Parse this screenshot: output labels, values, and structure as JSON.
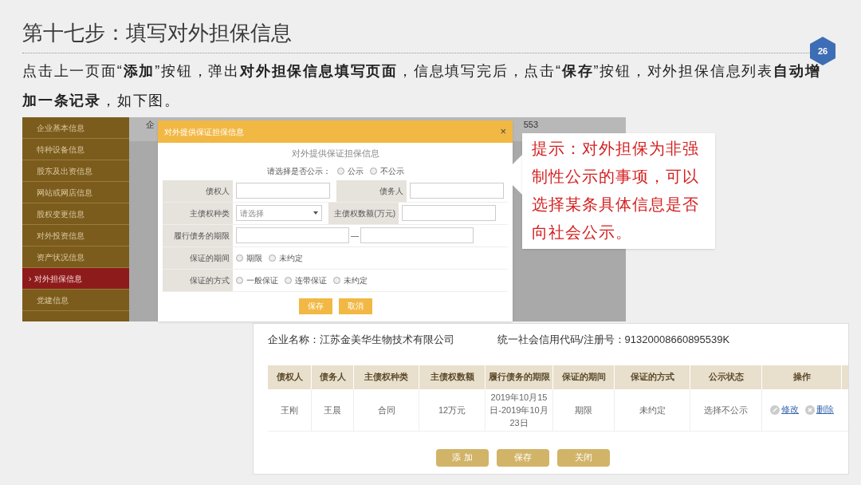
{
  "slide": {
    "title": "第十七步：填写对外担保信息",
    "page_number": "26",
    "description": "点击上一页面“**添加**”按钮，弹出**对外担保信息填写页面**，信息填写完后，点击“**保存**”按钮，对外担保信息列表**自动增加一条记录**，如下图。"
  },
  "form_screenshot": {
    "sidebar": [
      {
        "label": "企业基本信息",
        "selected": false
      },
      {
        "label": "特种设备信息",
        "selected": false
      },
      {
        "label": "股东及出资信息",
        "selected": false
      },
      {
        "label": "网站或网店信息",
        "selected": false
      },
      {
        "label": "股权变更信息",
        "selected": false
      },
      {
        "label": "对外投资信息",
        "selected": false
      },
      {
        "label": "资产状况信息",
        "selected": false
      },
      {
        "label": "对外担保信息",
        "selected": true,
        "marker": "›"
      },
      {
        "label": "党建信息",
        "selected": false
      }
    ],
    "background_texts": [
      "企",
      "553"
    ],
    "dialog": {
      "title": "对外提供保证担保信息",
      "close": "×",
      "heading": "对外提供保证担保信息",
      "publicity_prompt": "请选择是否公示：",
      "publicity_options": [
        {
          "label": "公示",
          "selected": false
        },
        {
          "label": "不公示",
          "selected": false
        }
      ],
      "rows": [
        [
          {
            "kind": "text",
            "label": "债权人"
          },
          {
            "kind": "text",
            "label": "债务人"
          }
        ],
        [
          {
            "kind": "select",
            "label": "主债权种类",
            "placeholder": "请选择"
          },
          {
            "kind": "text",
            "label": "主债权数额(万元)"
          }
        ],
        [
          {
            "kind": "range",
            "label": "履行债务的期限",
            "separator": "—"
          }
        ],
        [
          {
            "kind": "radio",
            "label": "保证的期间",
            "options": [
              {
                "label": "期限",
                "selected": false
              },
              {
                "label": "未约定",
                "selected": false
              }
            ]
          }
        ],
        [
          {
            "kind": "radio",
            "label": "保证的方式",
            "options": [
              {
                "label": "一般保证",
                "selected": false
              },
              {
                "label": "连带保证",
                "selected": false
              },
              {
                "label": "未约定",
                "selected": false
              }
            ]
          }
        ]
      ],
      "buttons": [
        "保存",
        "取消"
      ]
    }
  },
  "callout": {
    "text": "提示：对外担保为非强制性公示的事项，可以选择某条具体信息是否向社会公示。"
  },
  "list_screenshot": {
    "company_name": "企业名称：江苏金美华生物技术有限公司",
    "credit_code": "统一社会信用代码/注册号：91320008660895539K",
    "table": {
      "columns": [
        "债权人",
        "债务人",
        "主债权种类",
        "主债权数额",
        "履行债务的期限",
        "保证的期间",
        "保证的方式",
        "公示状态",
        "操作"
      ],
      "rows": [
        {
          "cells": [
            "王刚",
            "王晨",
            "合同",
            "12万元",
            "2019年10月15日-2019年10月23日",
            "期限",
            "未约定",
            "选择不公示"
          ],
          "actions": [
            {
              "kind": "edit",
              "label": "修改"
            },
            {
              "kind": "delete",
              "label": "删除"
            }
          ]
        }
      ]
    },
    "buttons": [
      "添 加",
      "保存",
      "关闭"
    ]
  }
}
